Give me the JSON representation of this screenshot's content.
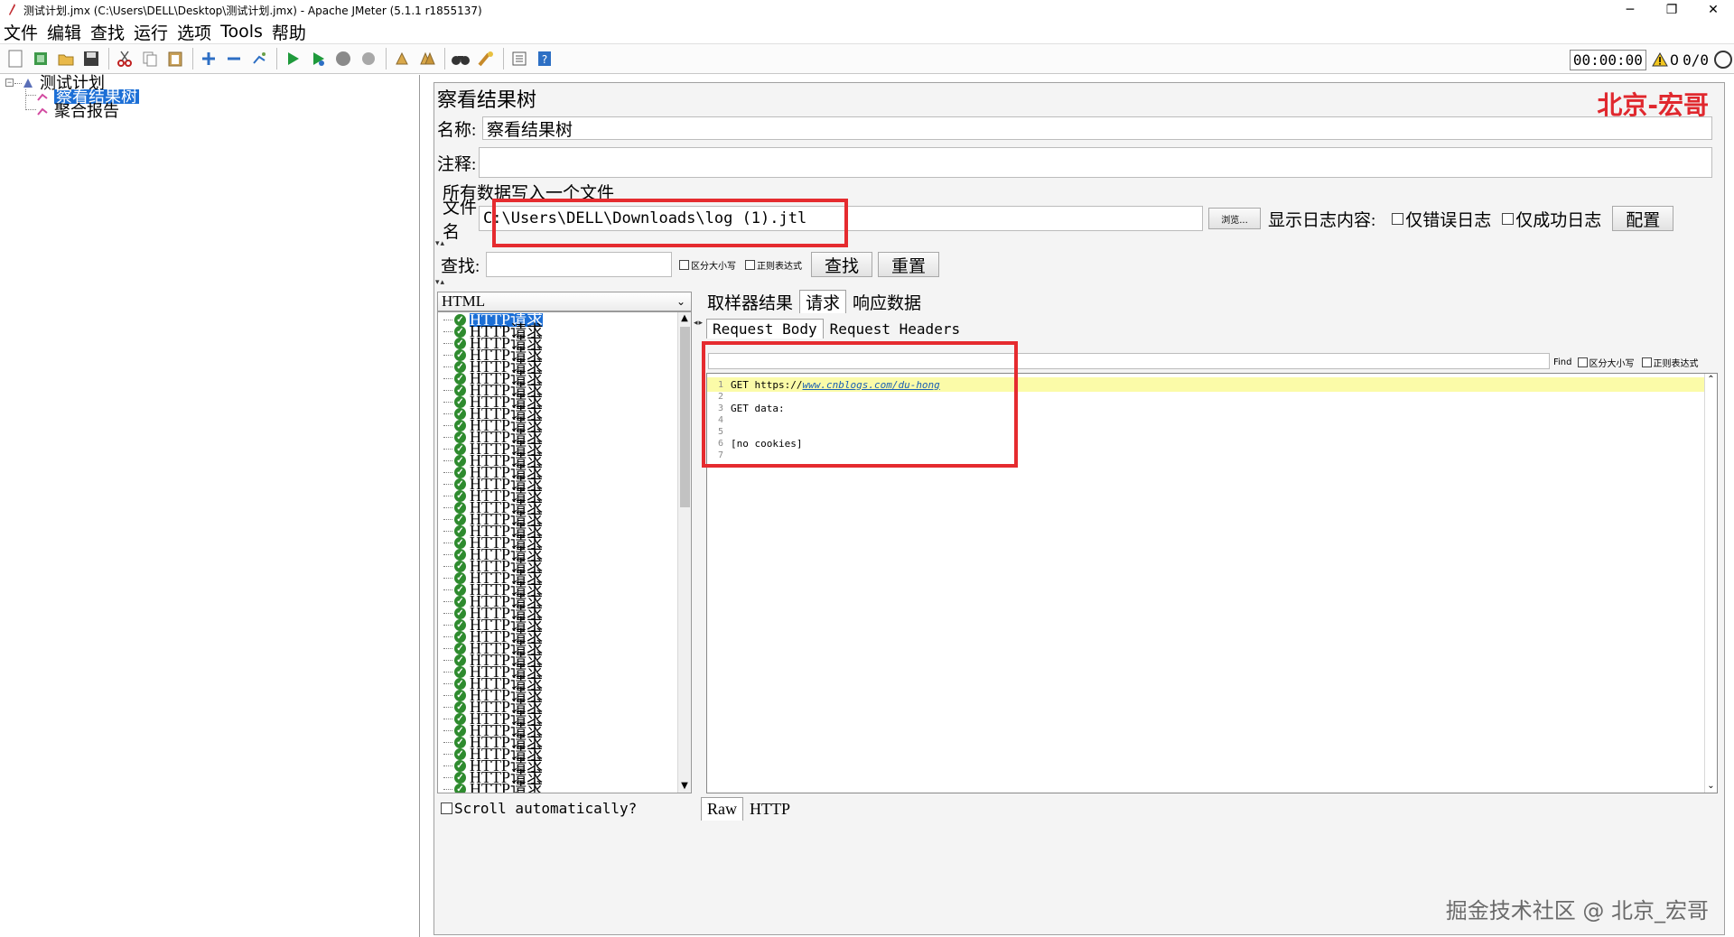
{
  "window": {
    "title": "测试计划.jmx (C:\\Users\\DELL\\Desktop\\测试计划.jmx) - Apache JMeter (5.1.1 r1855137)",
    "minimize": "─",
    "restore": "❐",
    "close": "✕"
  },
  "menu": [
    "文件",
    "编辑",
    "查找",
    "运行",
    "选项",
    "Tools",
    "帮助"
  ],
  "toolbar": {
    "timer": "00:00:00",
    "warnings": "0",
    "threads": "0/0"
  },
  "tree": {
    "root": "测试计划",
    "children": [
      "察看结果树",
      "聚合报告"
    ]
  },
  "panel": {
    "title": "察看结果树",
    "brand": "北京-宏哥",
    "name_label": "名称:",
    "name_value": "察看结果树",
    "comment_label": "注释:",
    "comment_value": "",
    "file_section": "所有数据写入一个文件",
    "file_label": "文件名",
    "file_value": "C:\\Users\\DELL\\Downloads\\log (1).jtl",
    "browse": "浏览...",
    "log_display": "显示日志内容:",
    "errors_only": "仅错误日志",
    "success_only": "仅成功日志",
    "configure": "配置"
  },
  "search": {
    "label": "查找:",
    "value": "",
    "case_sensitive": "区分大小写",
    "regex": "正则表达式",
    "find_button": "查找",
    "reset_button": "重置"
  },
  "samples": {
    "renderer": "HTML",
    "items": [
      "HTTP请求",
      "HTTP请求",
      "HTTP请求",
      "HTTP请求",
      "HTTP请求",
      "HTTP请求",
      "HTTP请求",
      "HTTP请求",
      "HTTP请求",
      "HTTP请求",
      "HTTP请求",
      "HTTP请求",
      "HTTP请求",
      "HTTP请求",
      "HTTP请求",
      "HTTP请求",
      "HTTP请求",
      "HTTP请求",
      "HTTP请求",
      "HTTP请求",
      "HTTP请求",
      "HTTP请求",
      "HTTP请求",
      "HTTP请求",
      "HTTP请求",
      "HTTP请求",
      "HTTP请求",
      "HTTP请求",
      "HTTP请求",
      "HTTP请求",
      "HTTP请求",
      "HTTP请求",
      "HTTP请求",
      "HTTP请求",
      "HTTP请求",
      "HTTP请求",
      "HTTP请求",
      "HTTP请求",
      "HTTP请求",
      "HTTP请求",
      "HTTP请求"
    ],
    "scroll_auto": "Scroll automatically?"
  },
  "result_tabs": [
    "取样器结果",
    "请求",
    "响应数据"
  ],
  "request_tabs": [
    "Request Body",
    "Request Headers"
  ],
  "find_bar": {
    "label": "Find",
    "case_sensitive": "区分大小写",
    "regex": "正则表达式"
  },
  "code": {
    "lines": [
      {
        "n": "1",
        "pre": "GET https://",
        "link": "www.cnblogs.com/du-hong",
        "post": ""
      },
      {
        "n": "2",
        "pre": "",
        "link": "",
        "post": ""
      },
      {
        "n": "3",
        "pre": "GET data:",
        "link": "",
        "post": ""
      },
      {
        "n": "4",
        "pre": "",
        "link": "",
        "post": ""
      },
      {
        "n": "5",
        "pre": "",
        "link": "",
        "post": ""
      },
      {
        "n": "6",
        "pre": "[no cookies]",
        "link": "",
        "post": ""
      },
      {
        "n": "7",
        "pre": "",
        "link": "",
        "post": ""
      }
    ]
  },
  "bottom_tabs": [
    "Raw",
    "HTTP"
  ],
  "watermark": "掘金技术社区 @ 北京_宏哥",
  "colors": {
    "selection": "#1c6fd6",
    "highlight_box": "#e52b2f",
    "brand": "#e0282e",
    "success_icon": "#2e8b2e"
  }
}
